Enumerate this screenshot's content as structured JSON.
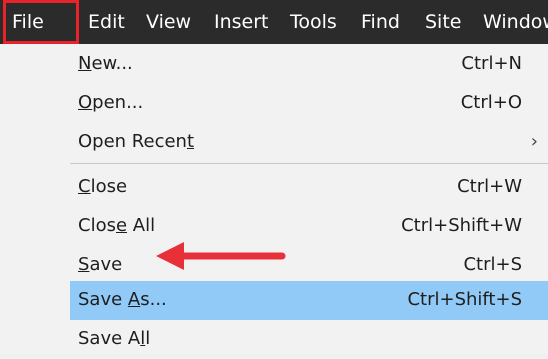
{
  "menubar": {
    "items": [
      "File",
      "Edit",
      "View",
      "Insert",
      "Tools",
      "Find",
      "Site",
      "Window"
    ]
  },
  "file_menu": {
    "items": [
      {
        "label": "New...",
        "mnemonic_index": 0,
        "shortcut": "Ctrl+N"
      },
      {
        "label": "Open...",
        "mnemonic_index": 0,
        "shortcut": "Ctrl+O"
      },
      {
        "label": "Open Recent",
        "mnemonic_index": 10,
        "shortcut": "",
        "submenu": true
      },
      {
        "label": "Close",
        "mnemonic_index": 0,
        "shortcut": "Ctrl+W"
      },
      {
        "label": "Close All",
        "mnemonic_index": 4,
        "shortcut": "Ctrl+Shift+W"
      },
      {
        "label": "Save",
        "mnemonic_index": 0,
        "shortcut": "Ctrl+S"
      },
      {
        "label": "Save As...",
        "mnemonic_index": 5,
        "shortcut": "Ctrl+Shift+S",
        "selected": true
      },
      {
        "label": "Save All",
        "mnemonic_index": 6,
        "shortcut": ""
      }
    ]
  },
  "colors": {
    "menubar_bg": "#2b2b2b",
    "highlight_box": "#e8242b",
    "selected_bg": "#91c9f7",
    "arrow": "#e8303a"
  }
}
